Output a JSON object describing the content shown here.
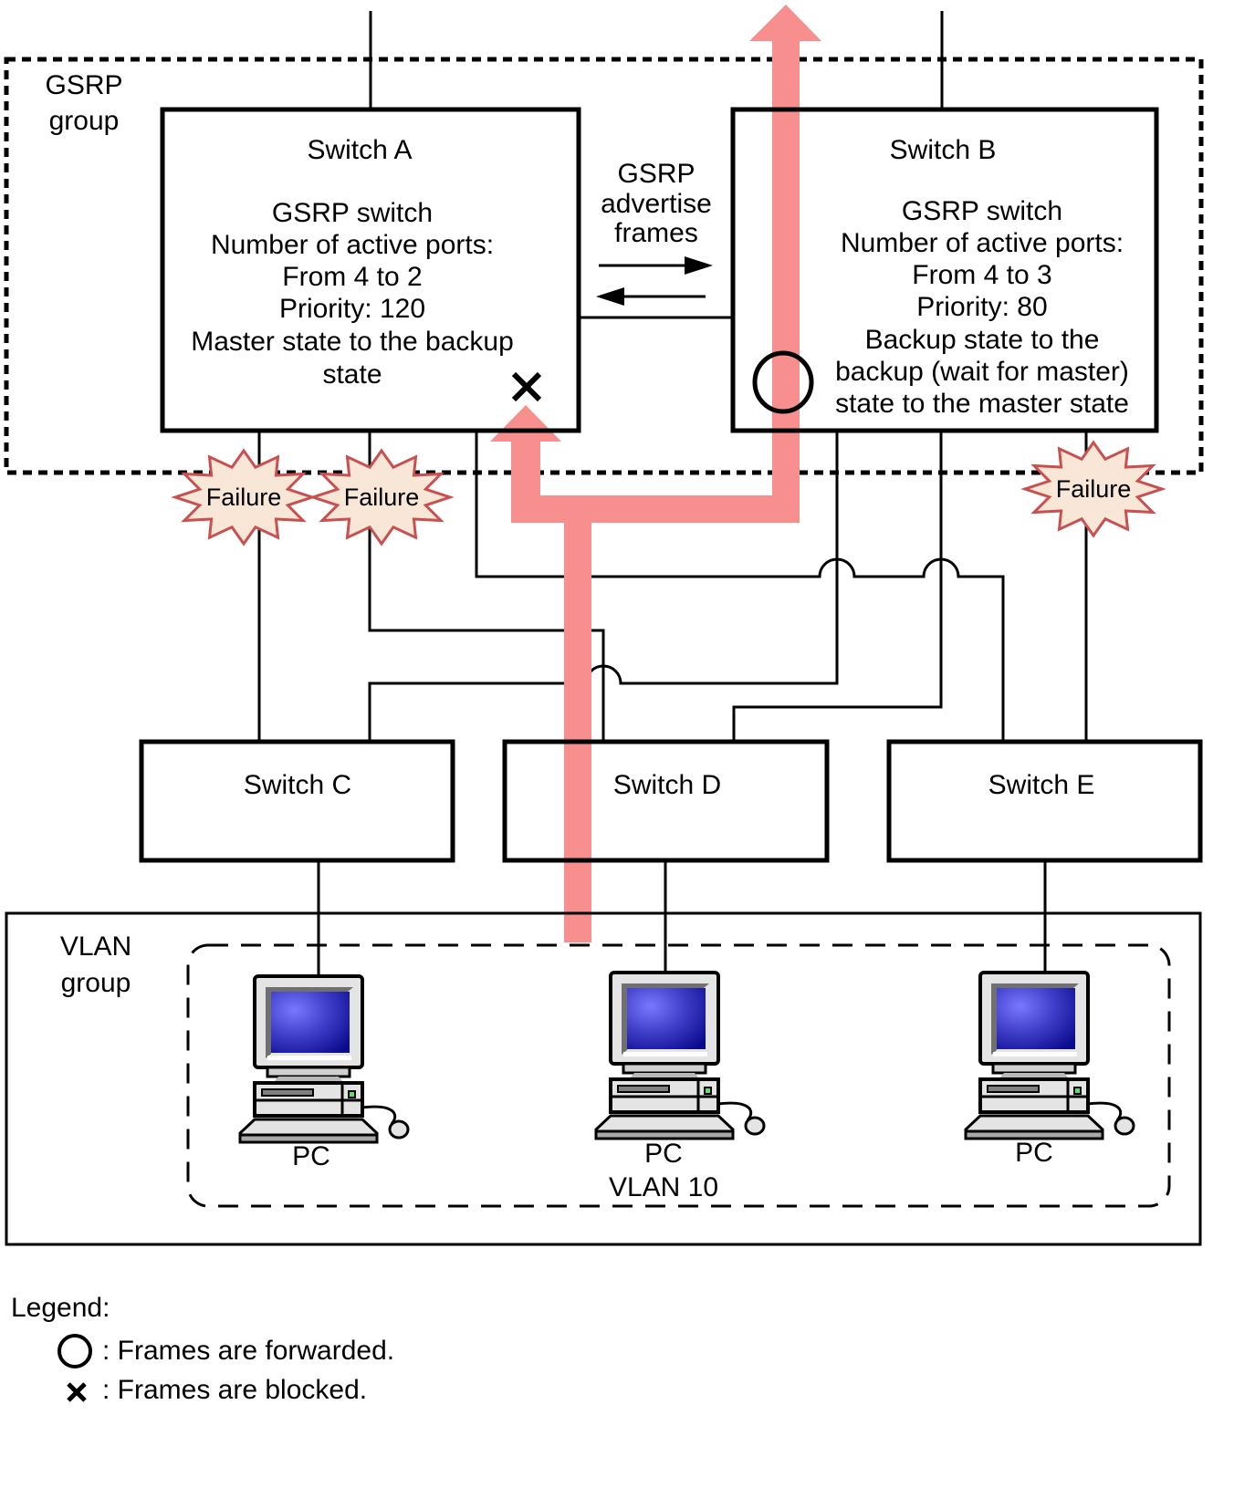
{
  "gsrp_group": {
    "label_lines": [
      "GSRP",
      "group"
    ]
  },
  "switch_a": {
    "title": "Switch A",
    "lines": [
      "GSRP switch",
      "Number of active ports:",
      "From 4 to 2",
      "Priority: 120",
      "Master state to the backup",
      "state"
    ],
    "port_state": "blocked"
  },
  "switch_b": {
    "title": "Switch B",
    "lines": [
      "GSRP switch",
      "Number of active ports:",
      "From 4 to 3",
      "Priority: 80",
      "Backup state to the",
      "backup (wait for master)",
      "state to the master state"
    ],
    "port_state": "forwarded"
  },
  "advertise": {
    "label_lines": [
      "GSRP",
      "advertise",
      "frames"
    ]
  },
  "failures": [
    "Failure",
    "Failure",
    "Failure"
  ],
  "switches_lower": [
    {
      "title": "Switch C"
    },
    {
      "title": "Switch D"
    },
    {
      "title": "Switch E"
    }
  ],
  "vlan_group": {
    "label_lines": [
      "VLAN",
      "group"
    ]
  },
  "pcs": [
    {
      "label": "PC"
    },
    {
      "label": "PC",
      "sublabel": "VLAN 10"
    },
    {
      "label": "PC"
    }
  ],
  "legend": {
    "title": "Legend:",
    "items": [
      {
        "symbol": "circle",
        "text": ": Frames are forwarded."
      },
      {
        "symbol": "cross",
        "text": ": Frames are blocked."
      }
    ]
  },
  "colors": {
    "flow": "#f78f8f",
    "failure_fill": "#f8e6d6",
    "failure_stroke": "#c85050",
    "screen": "#2020a8"
  }
}
